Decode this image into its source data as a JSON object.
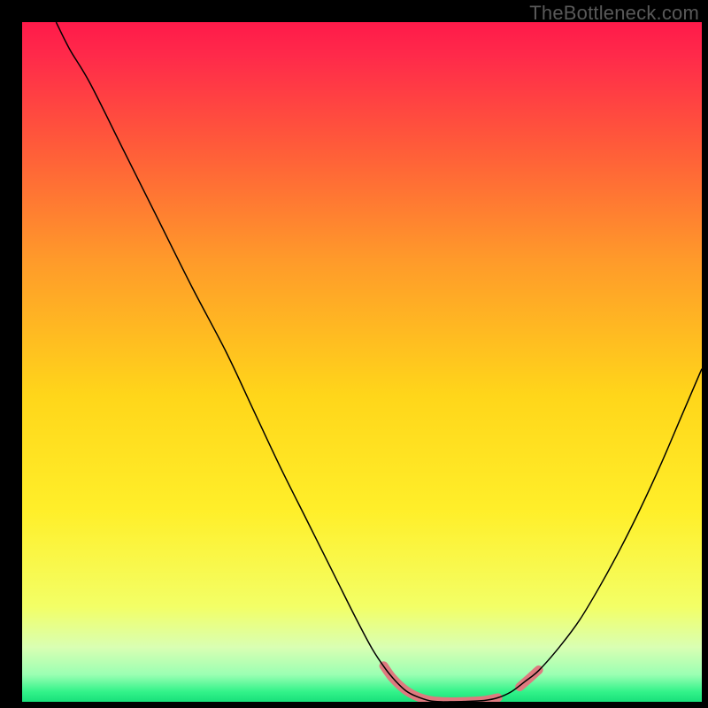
{
  "watermark": "TheBottleneck.com",
  "plot": {
    "inner_left": 25,
    "inner_top": 25,
    "inner_right": 793,
    "inner_bottom": 793
  },
  "chart_data": {
    "type": "line",
    "title": "",
    "xlabel": "",
    "ylabel": "",
    "xlim": [
      0,
      100
    ],
    "ylim": [
      0,
      100
    ],
    "grid": false,
    "legend": false,
    "background_gradient_stops": [
      {
        "offset": 0.0,
        "color": "#ff1a4a"
      },
      {
        "offset": 0.05,
        "color": "#ff2a4a"
      },
      {
        "offset": 0.18,
        "color": "#ff5a3a"
      },
      {
        "offset": 0.35,
        "color": "#ff9a2a"
      },
      {
        "offset": 0.55,
        "color": "#ffd61a"
      },
      {
        "offset": 0.72,
        "color": "#ffef2a"
      },
      {
        "offset": 0.86,
        "color": "#f3ff66"
      },
      {
        "offset": 0.92,
        "color": "#d9ffb3"
      },
      {
        "offset": 0.96,
        "color": "#9bffb3"
      },
      {
        "offset": 0.985,
        "color": "#33f38a"
      },
      {
        "offset": 1.0,
        "color": "#18e07a"
      }
    ],
    "series": [
      {
        "name": "curve-left",
        "color": "#000000",
        "width": 1.5,
        "points": [
          {
            "x": 5.0,
            "y": 100.0
          },
          {
            "x": 7.0,
            "y": 96.0
          },
          {
            "x": 10.0,
            "y": 91.0
          },
          {
            "x": 15.0,
            "y": 81.0
          },
          {
            "x": 20.0,
            "y": 71.0
          },
          {
            "x": 25.0,
            "y": 61.0
          },
          {
            "x": 30.0,
            "y": 51.5
          },
          {
            "x": 34.0,
            "y": 43.0
          },
          {
            "x": 38.0,
            "y": 34.5
          },
          {
            "x": 42.0,
            "y": 26.5
          },
          {
            "x": 46.0,
            "y": 18.5
          },
          {
            "x": 49.0,
            "y": 12.5
          },
          {
            "x": 51.5,
            "y": 7.8
          },
          {
            "x": 53.5,
            "y": 4.8
          },
          {
            "x": 55.0,
            "y": 3.0
          },
          {
            "x": 56.5,
            "y": 1.6
          },
          {
            "x": 58.0,
            "y": 0.8
          },
          {
            "x": 60.0,
            "y": 0.15
          },
          {
            "x": 62.0,
            "y": 0.0
          }
        ]
      },
      {
        "name": "curve-right",
        "color": "#000000",
        "width": 1.5,
        "points": [
          {
            "x": 62.0,
            "y": 0.0
          },
          {
            "x": 65.0,
            "y": 0.05
          },
          {
            "x": 68.0,
            "y": 0.2
          },
          {
            "x": 70.0,
            "y": 0.6
          },
          {
            "x": 72.0,
            "y": 1.5
          },
          {
            "x": 74.0,
            "y": 3.0
          },
          {
            "x": 76.0,
            "y": 4.6
          },
          {
            "x": 79.0,
            "y": 8.0
          },
          {
            "x": 82.0,
            "y": 12.0
          },
          {
            "x": 85.0,
            "y": 17.0
          },
          {
            "x": 88.0,
            "y": 22.5
          },
          {
            "x": 91.0,
            "y": 28.5
          },
          {
            "x": 94.0,
            "y": 35.0
          },
          {
            "x": 97.0,
            "y": 42.0
          },
          {
            "x": 100.0,
            "y": 49.0
          }
        ]
      },
      {
        "name": "highlight-dashes-left",
        "color": "#de7a7f",
        "width": 10,
        "linecap": "round",
        "points": [
          {
            "x": 53.2,
            "y": 5.3
          },
          {
            "x": 54.5,
            "y": 3.5
          },
          {
            "x": 56.3,
            "y": 1.8
          },
          {
            "x": 58.3,
            "y": 0.7
          },
          {
            "x": 60.4,
            "y": 0.15
          },
          {
            "x": 63.0,
            "y": 0.0
          },
          {
            "x": 65.5,
            "y": 0.05
          },
          {
            "x": 68.0,
            "y": 0.2
          },
          {
            "x": 70.0,
            "y": 0.6
          }
        ]
      },
      {
        "name": "highlight-dashes-right",
        "color": "#de7a7f",
        "width": 10,
        "linecap": "round",
        "points": [
          {
            "x": 73.2,
            "y": 2.2
          },
          {
            "x": 74.8,
            "y": 3.6
          },
          {
            "x": 76.0,
            "y": 4.7
          }
        ]
      }
    ]
  }
}
